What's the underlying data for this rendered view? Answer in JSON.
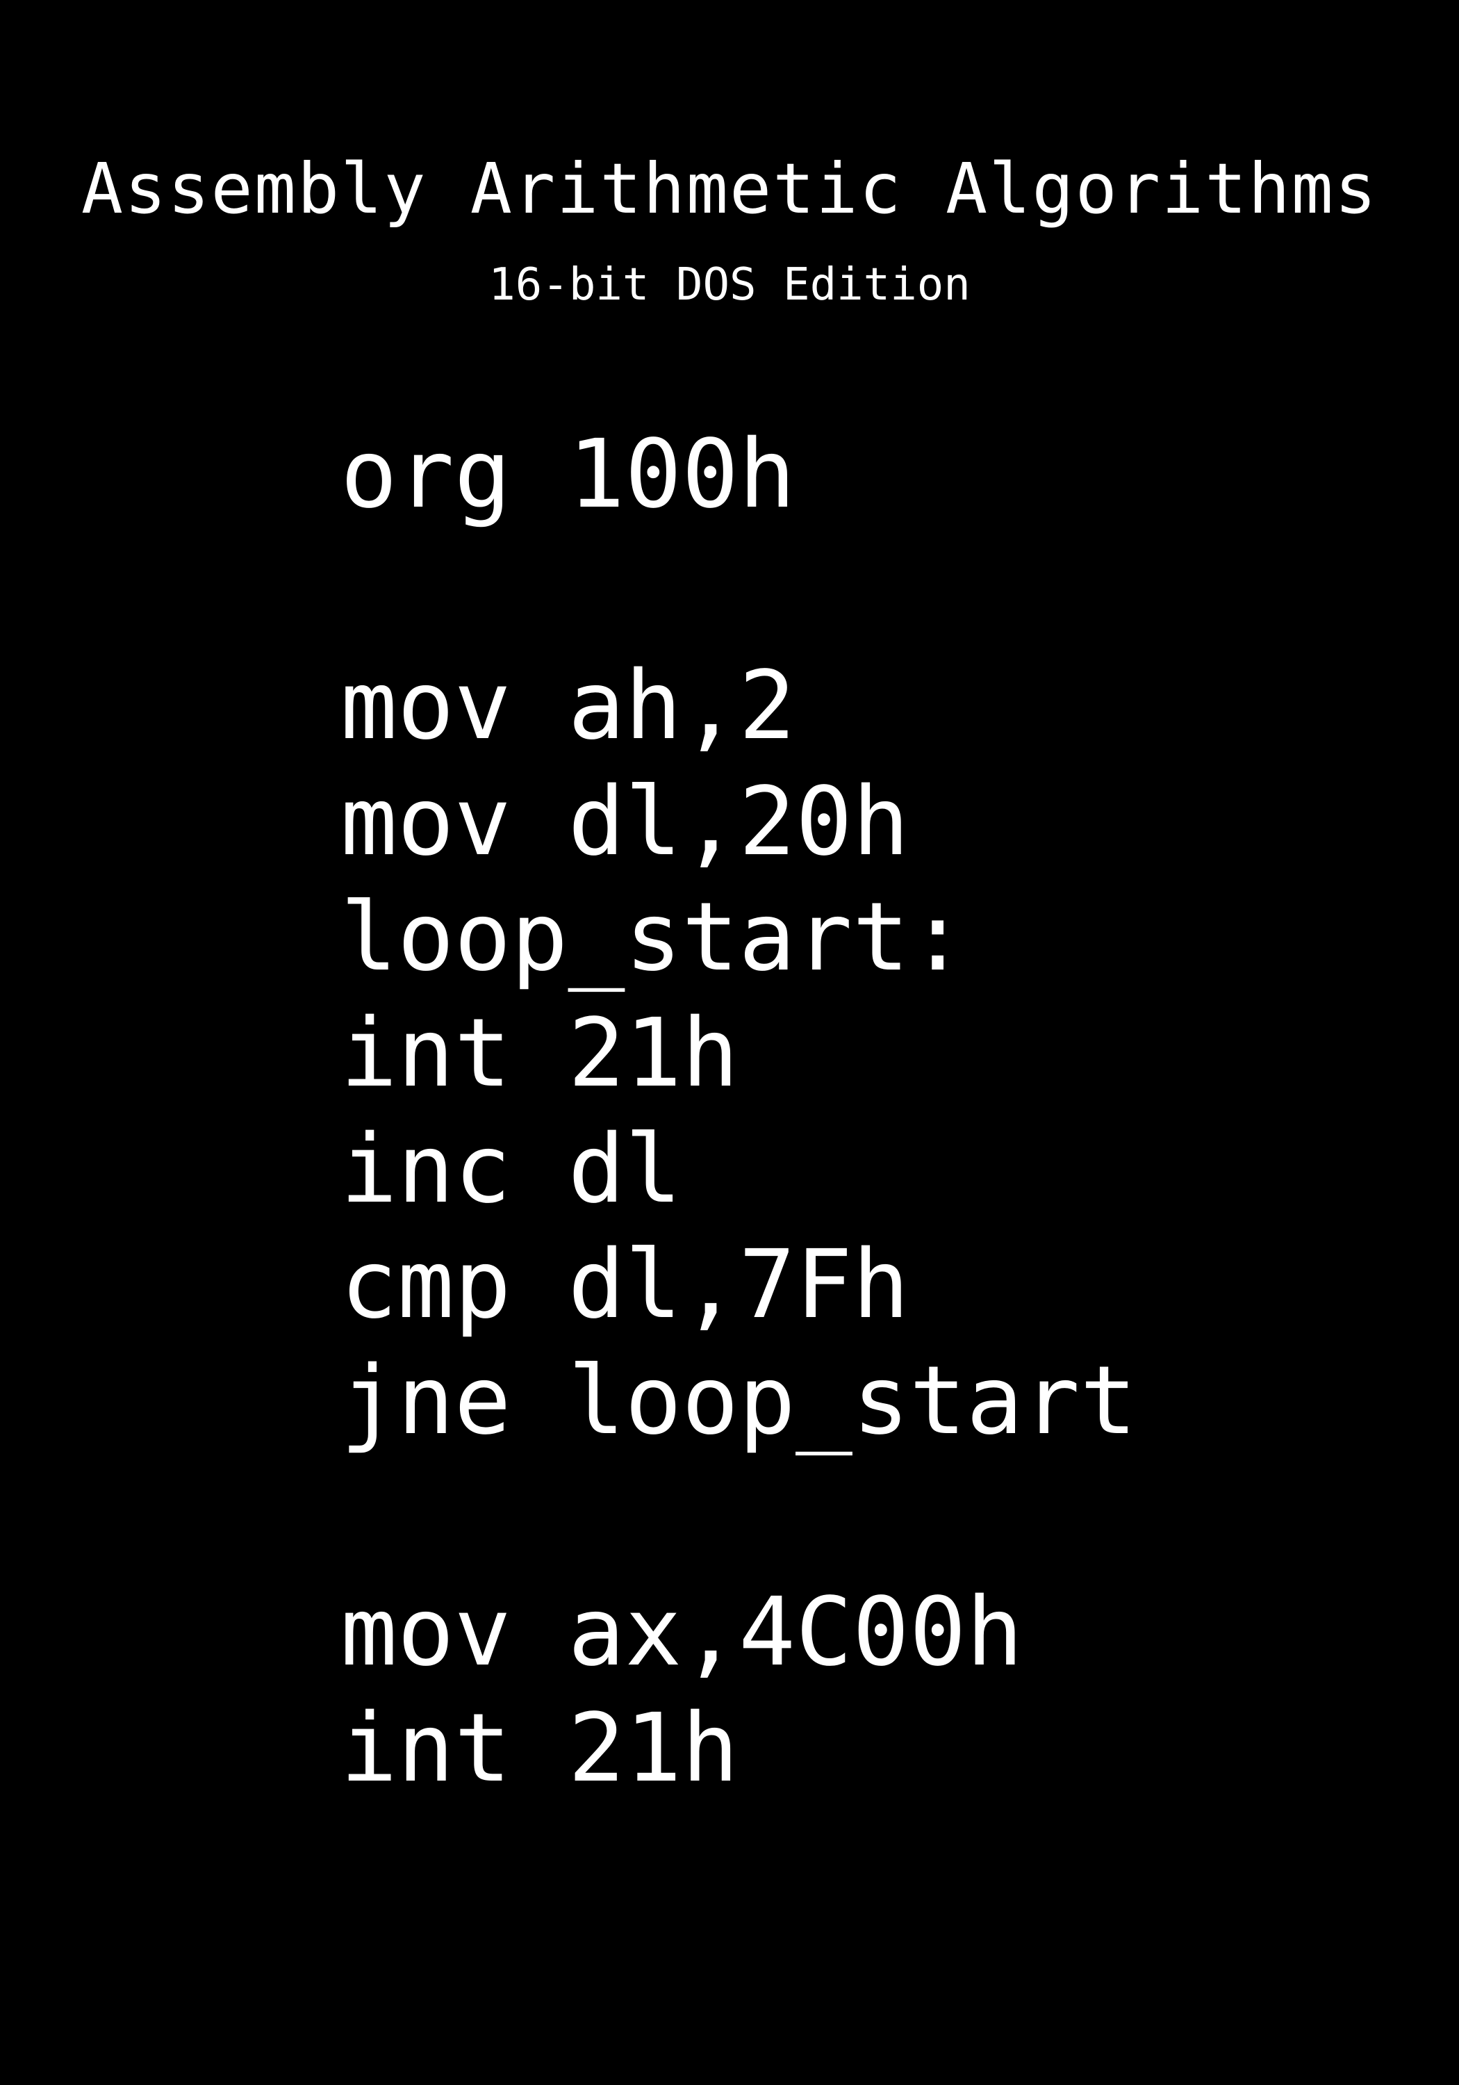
{
  "title": "Assembly Arithmetic Algorithms",
  "subtitle": "16-bit DOS Edition",
  "code_lines": [
    "org 100h",
    "",
    "mov ah,2",
    "mov dl,20h",
    "loop_start:",
    "int 21h",
    "inc dl",
    "cmp dl,7Fh",
    "jne loop_start",
    "",
    "mov ax,4C00h",
    "int 21h"
  ],
  "colors": {
    "background": "#000000",
    "text": "#ffffff"
  }
}
